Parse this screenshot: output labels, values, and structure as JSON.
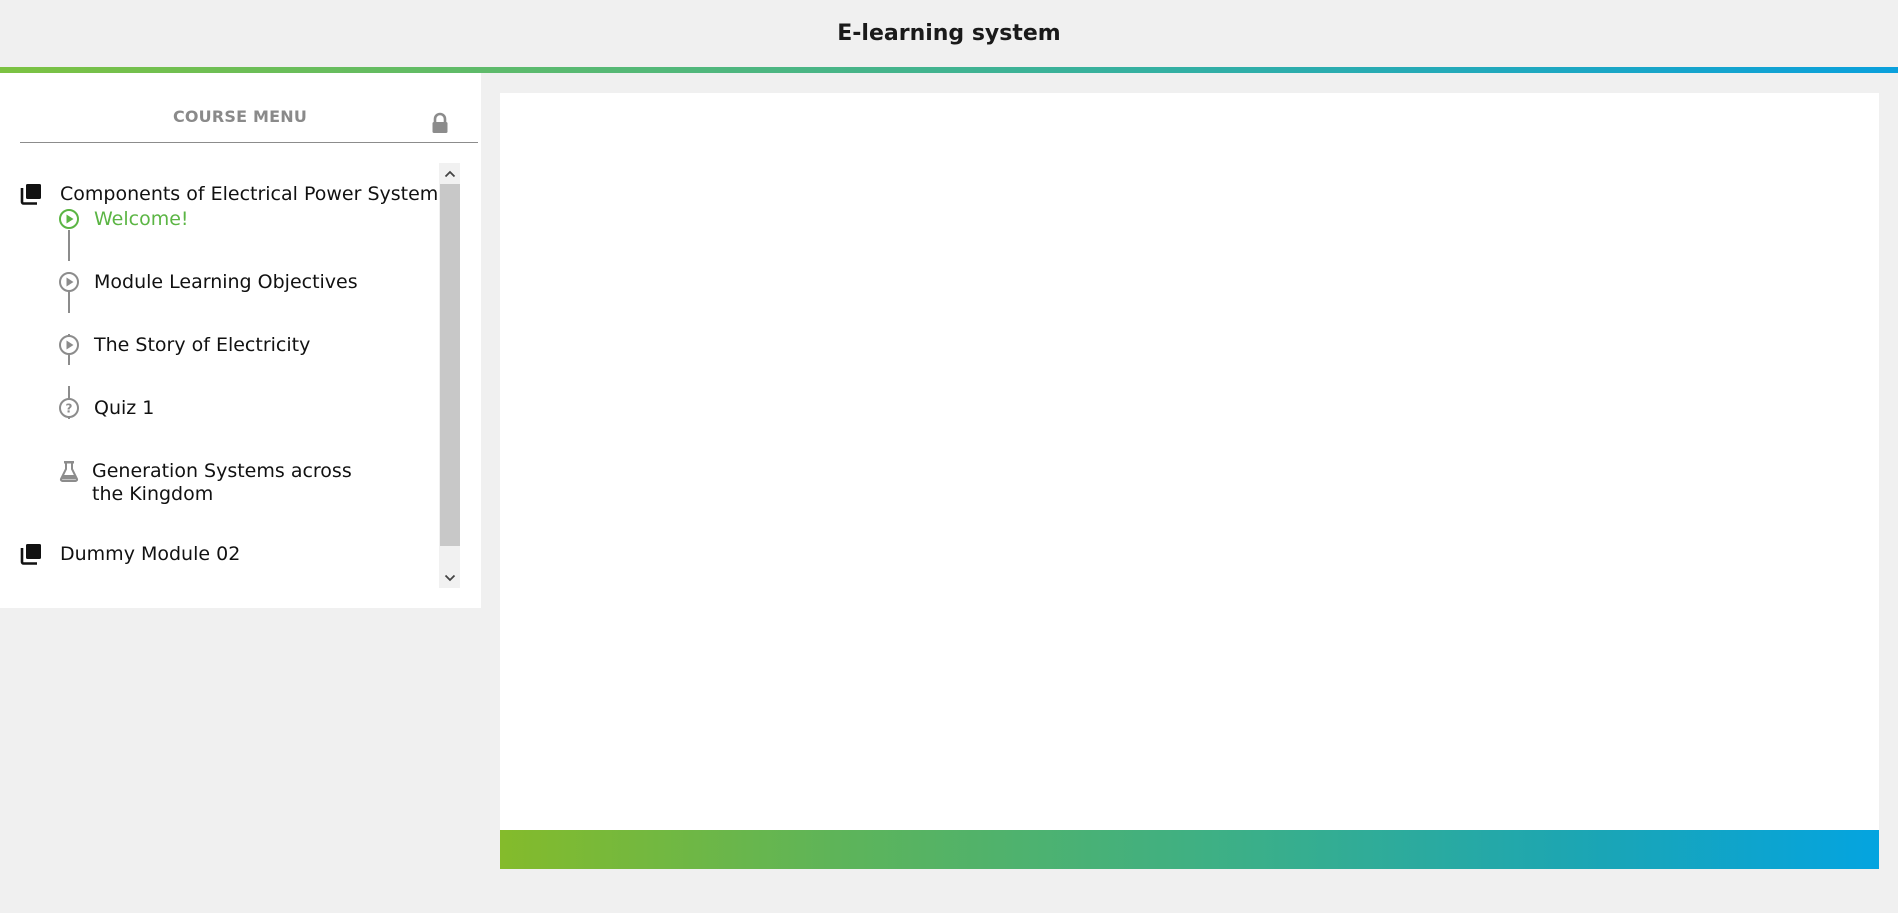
{
  "app": {
    "title": "E-learning system"
  },
  "colors": {
    "accent_green": "#5bb544",
    "accent_blue": "#04a4e0",
    "icon_gray": "#8c8c8c"
  },
  "course_menu": {
    "title": "COURSE MENU",
    "lock_icon": "lock-icon",
    "modules": [
      {
        "label": "Components of Electrical Power System",
        "icon": "stacked-squares-icon",
        "lessons": [
          {
            "label": "Welcome!",
            "icon": "play-circle-icon",
            "active": true
          },
          {
            "label": "Module Learning Objectives",
            "icon": "play-circle-icon",
            "active": false
          },
          {
            "label": "The Story of Electricity",
            "icon": "play-circle-icon",
            "active": false
          },
          {
            "label": "Quiz 1",
            "icon": "question-circle-icon",
            "active": false
          },
          {
            "label": "Generation Systems across the Kingdom",
            "icon": "flask-icon",
            "active": false
          }
        ]
      },
      {
        "label": "Dummy Module 02",
        "icon": "stacked-squares-icon",
        "lessons": []
      }
    ]
  },
  "scrollbar": {
    "up_icon": "chevron-up-icon",
    "down_icon": "chevron-down-icon"
  }
}
